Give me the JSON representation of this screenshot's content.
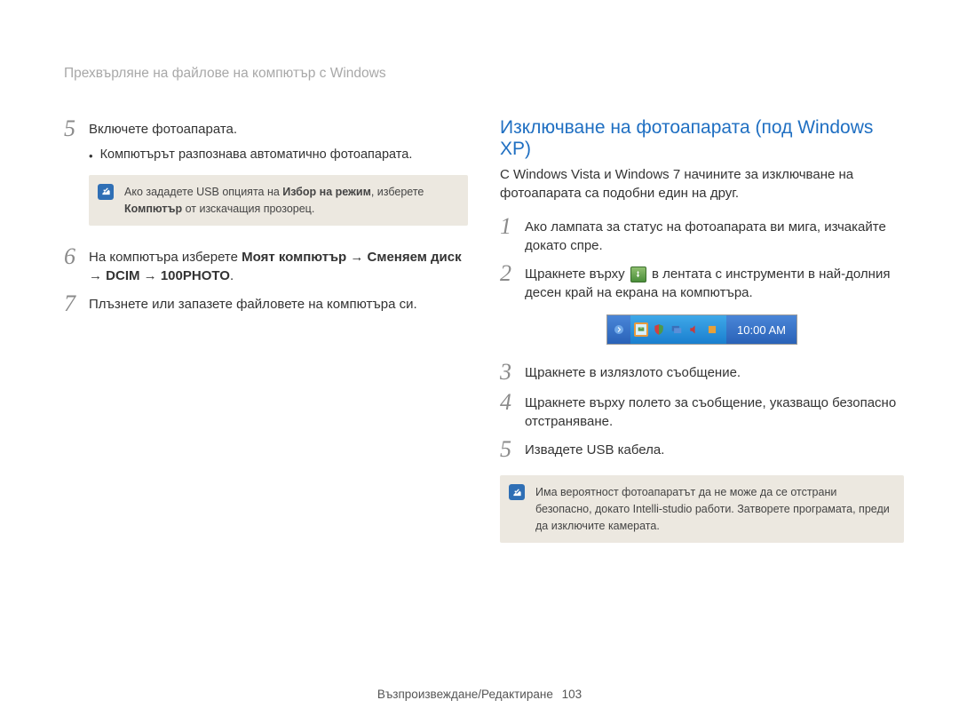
{
  "header": "Прехвърляне на файлове на компютър с Windows",
  "left": {
    "step5": {
      "num": "5",
      "text": "Включете фотоапарата.",
      "bullet": "Компютърът разпознава автоматично фотоапарата."
    },
    "note1": {
      "pre": "Ако зададете USB опцията на ",
      "b1": "Избор на режим",
      "mid": ", изберете ",
      "b2": "Компютър",
      "post": " от изскачащия прозорец."
    },
    "step6": {
      "num": "6",
      "pre": "На компютъра изберете ",
      "b1": "Моят компютър",
      "arrow": " → ",
      "b2": "Сменяем диск",
      "b3": "DCIM",
      "b4": "100PHOTO",
      "dot": "."
    },
    "step7": {
      "num": "7",
      "text": "Плъзнете или запазете файловете на компютъра си."
    }
  },
  "right": {
    "title": "Изключване на фотоапарата (под Windows XP)",
    "intro": "С Windows Vista и Windows 7 начините за изключване на фотоапарата са подобни един на друг.",
    "step1": {
      "num": "1",
      "text": "Ако лампата за статус на фотоапарата ви мига, изчакайте докато спре."
    },
    "step2": {
      "num": "2",
      "pre": "Щракнете върху ",
      "post": " в лентата с инструменти в най-долния десен край на екрана на компютъра."
    },
    "taskbar_time": "10:00 AM",
    "step3": {
      "num": "3",
      "text": "Щракнете в излязлото съобщение."
    },
    "step4": {
      "num": "4",
      "text": "Щракнете върху полето за съобщение, указващо безопасно отстраняване."
    },
    "step5": {
      "num": "5",
      "text": "Извадете USB кабела."
    },
    "note2": "Има вероятност фотоапаратът да не може да се отстрани безопасно, докато Intelli-studio работи. Затворете програмата, преди да изключите камерата."
  },
  "footer": {
    "section": "Възпроизвеждане/Редактиране",
    "page": "103"
  }
}
